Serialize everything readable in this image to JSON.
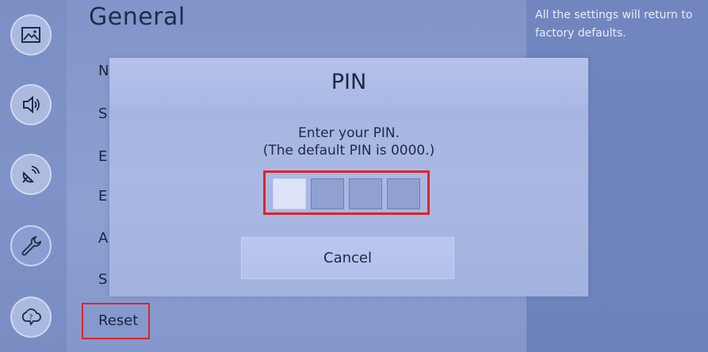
{
  "menu": {
    "title": "General",
    "items": [
      {
        "label": "N"
      },
      {
        "label": "S"
      },
      {
        "label": "E"
      },
      {
        "label": "E"
      },
      {
        "label": "A"
      },
      {
        "label": "S"
      }
    ],
    "reset_label": "Reset"
  },
  "help": {
    "text": "All the settings will return to factory defaults."
  },
  "sidebar": {
    "icons": [
      "picture-icon",
      "sound-icon",
      "broadcasting-icon",
      "general-icon",
      "support-icon"
    ],
    "active": "general-icon"
  },
  "dialog": {
    "title": "PIN",
    "prompt_line1": "Enter your PIN.",
    "prompt_line2": "(The default PIN is 0000.)",
    "pin_length": 4,
    "focused_digit": 1,
    "cancel_label": "Cancel"
  },
  "colors": {
    "highlight_red": "#e0222c",
    "dialog_bg": "#a9b9e3",
    "text_dark": "#1f2744"
  }
}
